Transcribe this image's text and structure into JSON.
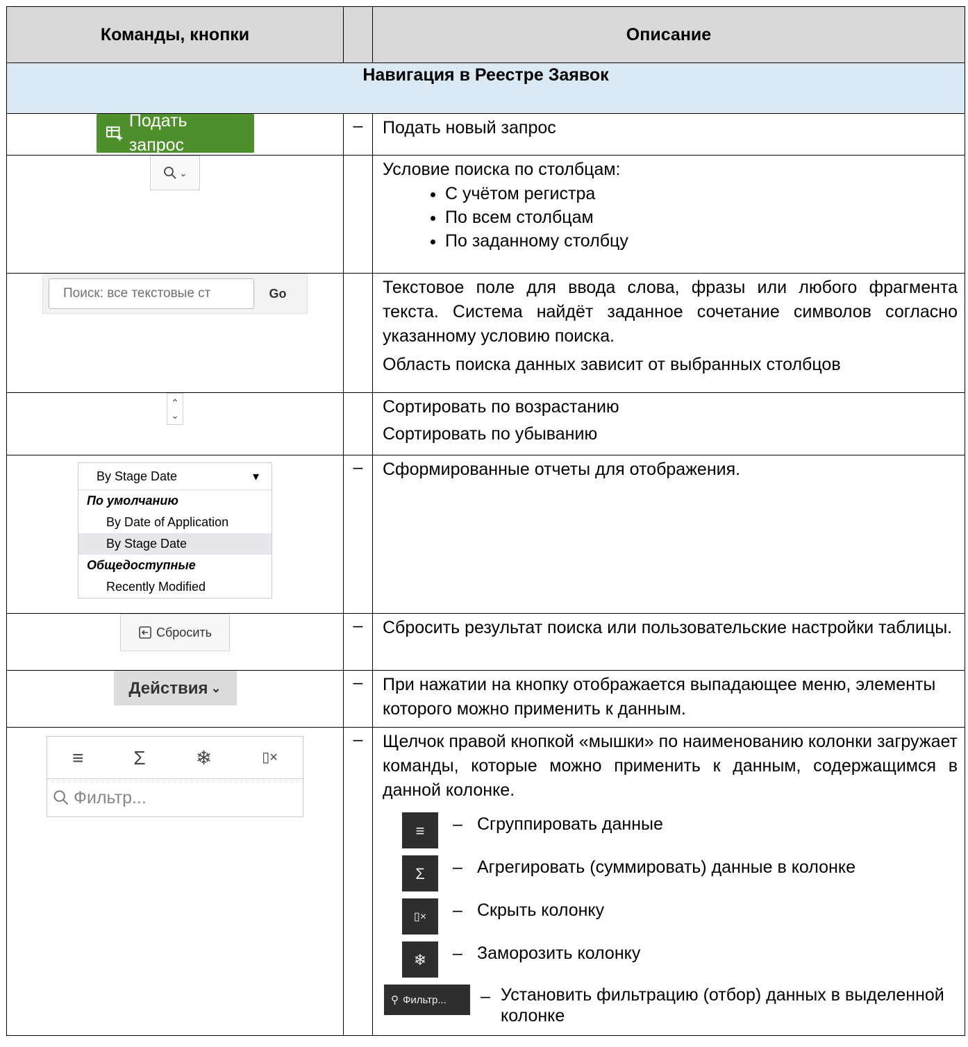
{
  "header": {
    "col1": "Команды, кнопки",
    "col3": "Описание"
  },
  "section_title": "Навигация в Реестре Заявок",
  "dash": "–",
  "rows": {
    "submit": {
      "button_label": "Подать запрос",
      "icon": "table-add-icon",
      "desc": "Подать новый запрос"
    },
    "search_condition": {
      "icon": "search-icon",
      "desc": "Условие поиска по столбцам:",
      "bullets": [
        "С учётом регистра",
        "По всем столбцам",
        "По заданному столбцу"
      ]
    },
    "search_field": {
      "placeholder": "Поиск: все текстовые ст",
      "go_label": "Go",
      "desc1": "Текстовое поле для ввода слова, фразы или любого фрагмента текста. Система найдёт заданное сочетание символов согласно указанному условию поиска.",
      "desc2": "Область поиска данных зависит от выбранных столбцов"
    },
    "sort": {
      "desc1": "Сортировать по возрастанию",
      "desc2": "Сортировать по убыванию"
    },
    "reports": {
      "selected": "By Stage Date",
      "group1": "По умолчанию",
      "opt1": "By Date of Application",
      "opt2": "By Stage Date",
      "group2": "Общедоступные",
      "opt3": "Recently Modified",
      "desc": "Сформированные отчеты для отображения."
    },
    "reset": {
      "button_label": "Сбросить",
      "desc": "Сбросить результат поиска или пользовательские настройки таблицы."
    },
    "actions": {
      "button_label": "Действия",
      "desc": "При нажатии на кнопку отображается выпадающее меню, элементы которого можно применить к данным."
    },
    "column_menu": {
      "filter_placeholder": "Фильтр...",
      "desc": "Щелчок правой кнопкой «мышки» по наименованию колонки загружает команды, которые можно применить к данным, содержащимся в данной колонке.",
      "items": [
        {
          "icon": "group-icon",
          "text": "Сгруппировать данные"
        },
        {
          "icon": "sigma-icon",
          "text": "Агрегировать (суммировать) данные в колонке"
        },
        {
          "icon": "hide-column-icon",
          "text": "Скрыть колонку"
        },
        {
          "icon": "snowflake-icon",
          "text": "Заморозить колонку"
        },
        {
          "icon": "filter-icon",
          "label": "Фильтр...",
          "text": "Установить фильтрацию (отбор) данных в выделенной колонке"
        }
      ]
    }
  }
}
